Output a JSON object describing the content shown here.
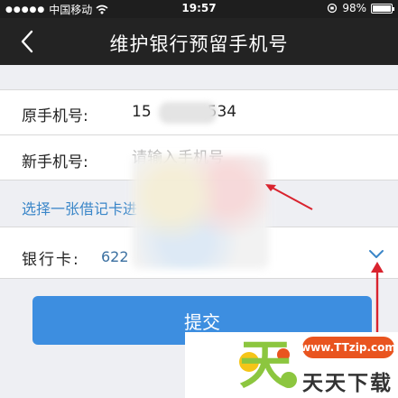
{
  "status_bar": {
    "carrier": "中国移动",
    "time": "19:57",
    "battery_text": "98%",
    "battery_level": 0.98,
    "icons": [
      "signal-dots-icon",
      "wifi-icon",
      "orientation-lock-icon",
      "battery-icon"
    ]
  },
  "nav": {
    "title": "维护银行预留手机号",
    "back_icon": "chevron-left-icon"
  },
  "form": {
    "old_phone": {
      "label": "原手机号:",
      "value_prefix": "15",
      "value_suffix": "534"
    },
    "new_phone": {
      "label": "新手机号:",
      "placeholder": "请输入手机号"
    },
    "hint_link": "选择一张借记卡进",
    "bank_card": {
      "label": "银行卡:",
      "value": "622"
    }
  },
  "submit": {
    "label": "提交"
  },
  "watermark": {
    "site": "www.TTzip.com",
    "name": "天天下载"
  },
  "colors": {
    "nav_bg": "#232323",
    "accent_blue": "#3d8ee0",
    "link_blue": "#3a86c8",
    "annotation_red": "#d9232e",
    "watermark_green": "#8cc63f",
    "watermark_orange": "#e9541f"
  }
}
